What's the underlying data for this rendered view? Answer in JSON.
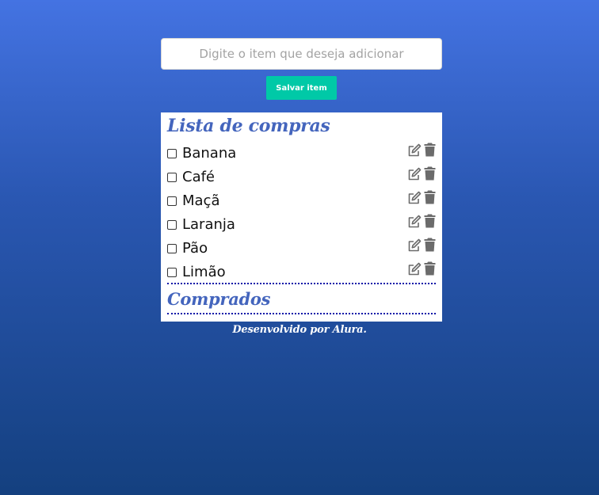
{
  "form": {
    "input_placeholder": "Digite o item que deseja adicionar",
    "input_value": "",
    "save_label": "Salvar item"
  },
  "shopping_list": {
    "title": "Lista de compras",
    "items": [
      {
        "label": "Banana",
        "checked": false
      },
      {
        "label": "Café",
        "checked": false
      },
      {
        "label": "Maçã",
        "checked": false
      },
      {
        "label": "Laranja",
        "checked": false
      },
      {
        "label": "Pão",
        "checked": false
      },
      {
        "label": "Limão",
        "checked": false
      }
    ],
    "item_icons": [
      "edit-icon",
      "trash-icon"
    ]
  },
  "bought_list": {
    "title": "Comprados",
    "items": []
  },
  "footer": {
    "text": "Desenvolvido por Alura."
  },
  "colors": {
    "background_top": "#4473e2",
    "background_bottom": "#14407f",
    "accent_button": "#00c9a7",
    "title_color": "#4465bd",
    "divider_color": "#0b17a8",
    "icon_color": "#6b6b6b"
  }
}
